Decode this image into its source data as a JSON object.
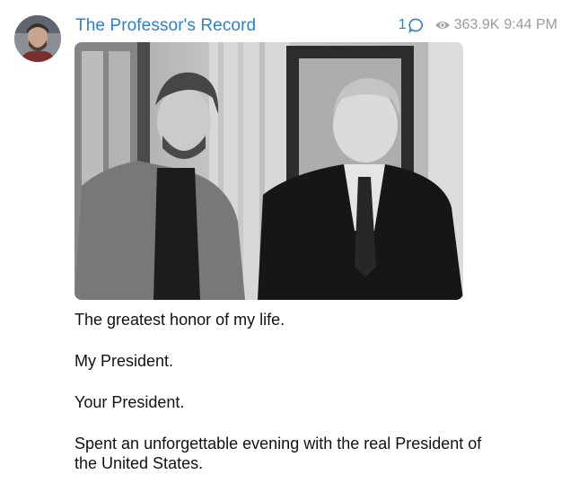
{
  "post": {
    "channel_name": "The Professor's Record",
    "reply_count": "1",
    "views": "363.9K",
    "time": "9:44 PM",
    "icons": {
      "reply": "comment-bubble-icon",
      "views": "eye-icon"
    },
    "colors": {
      "link": "#2f7fc9",
      "meta": "#9a9a9a"
    },
    "message_paragraphs": [
      "The greatest honor of my life.",
      "My President.",
      "Your President.",
      "Spent an unforgettable evening with the real President of the United States."
    ]
  }
}
